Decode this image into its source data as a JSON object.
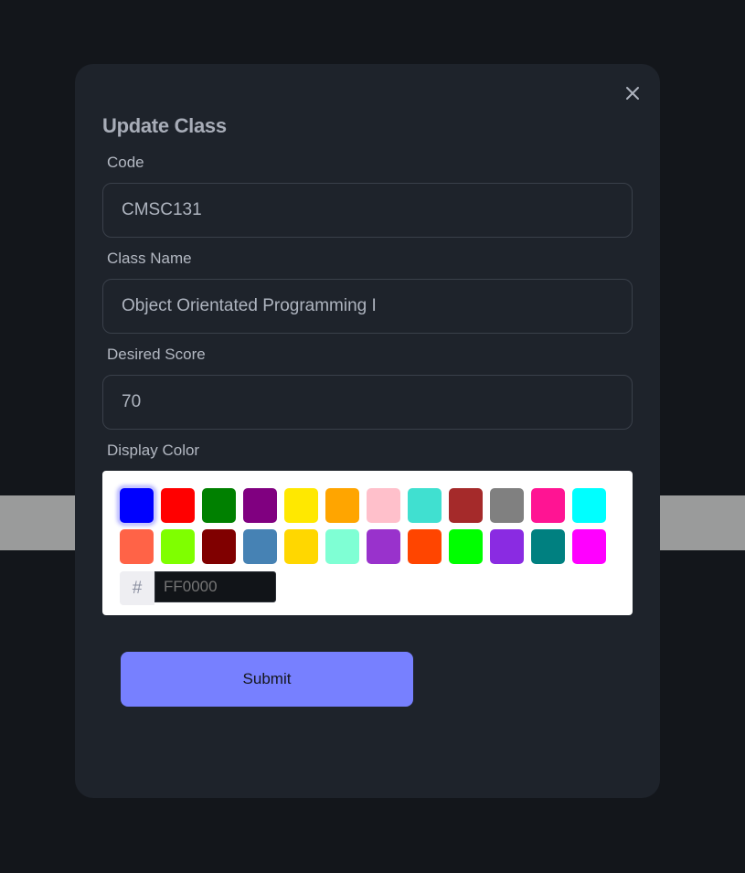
{
  "modal": {
    "title": "Update Class",
    "close_icon": "close-icon"
  },
  "form": {
    "code": {
      "label": "Code",
      "value": "CMSC131"
    },
    "class_name": {
      "label": "Class Name",
      "value": "Object Orientated Programming I"
    },
    "desired_score": {
      "label": "Desired Score",
      "value": "70"
    },
    "display_color": {
      "label": "Display Color",
      "selected_swatch": "#0000FF",
      "swatches": [
        [
          "#0000FF",
          "#FF0000",
          "#008000",
          "#800080",
          "#FFE800",
          "#FFA500",
          "#FFC0CB",
          "#40E0D0",
          "#A52A2A",
          "#808080",
          "#FF1493",
          "#00FFFF"
        ],
        [
          "#FF6347",
          "#7FFF00",
          "#800000",
          "#4682B4",
          "#FFD700",
          "#7FFFD4",
          "#9932CC",
          "#FF4500",
          "#00FF00",
          "#8A2BE2",
          "#008080",
          "#FF00FF"
        ]
      ],
      "hex_prefix": "#",
      "hex_placeholder": "FF0000",
      "hex_value": ""
    }
  },
  "actions": {
    "submit_label": "Submit"
  },
  "colors": {
    "accent": "#7780FF",
    "modal_bg": "#1E232B",
    "page_bg": "#13161B"
  }
}
